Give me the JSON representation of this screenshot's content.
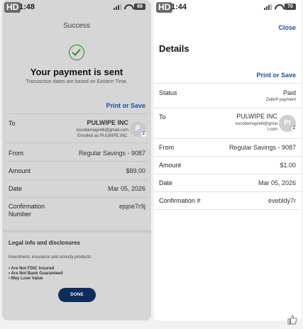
{
  "left": {
    "hd": "HD",
    "time": "1:48",
    "battery": "69",
    "title": "Success",
    "headline": "Your payment is sent",
    "note": "Transaction dates are based on Eastern Time.",
    "print_link": "Print or Save",
    "to": {
      "label": "To",
      "name": "PULWIPE INC",
      "email": "escobemayrelli@gmail.com",
      "enrolled": "Enrolled as PULWIPE INC.",
      "avatar": "P",
      "badge": "Z"
    },
    "from": {
      "label": "From",
      "value": "Regular Savings - 9087"
    },
    "amount": {
      "label": "Amount",
      "value": "$89.00"
    },
    "date": {
      "label": "Date",
      "value": "Mar 05, 2026"
    },
    "confirmation": {
      "label": "Confirmation Number",
      "value": "ejqoe7r9j"
    },
    "legal": {
      "title": "Legal info and disclosures",
      "subtitle": "Investment, insurance and annuity products:",
      "items": [
        "• Are Not FDIC Insured",
        "• Are Not Bank Guaranteed",
        "• May Lose Value"
      ]
    },
    "done": "DONE"
  },
  "right": {
    "hd": "HD",
    "time": "1:44",
    "battery": "70",
    "close": "Close",
    "title": "Details",
    "print_link": "Print or Save",
    "status": {
      "label": "Status",
      "value": "Paid",
      "sub": "Zelle® payment"
    },
    "to": {
      "label": "To",
      "name": "PULWIPE INC",
      "email1": "escobemayrelli@gmai",
      "email2": "l.com",
      "avatar": "PI",
      "badge": "Z"
    },
    "from": {
      "label": "From",
      "value": "Regular Savings - 9087"
    },
    "amount": {
      "label": "Amount",
      "value": "$1.00"
    },
    "date": {
      "label": "Date",
      "value": "Mar 05, 2026"
    },
    "confirmation": {
      "label": "Confirmation #",
      "value": "evebldy7r"
    }
  },
  "colors": {
    "accent_link": "#1f4f9e",
    "success_green": "#2e7d32",
    "done_button": "#0f2d5c",
    "zelle_purple": "#6d1ed4"
  },
  "icons": [
    "checkmark-circle-icon",
    "thumbs-up-icon",
    "signal-icon",
    "wifi-icon",
    "battery-icon"
  ]
}
